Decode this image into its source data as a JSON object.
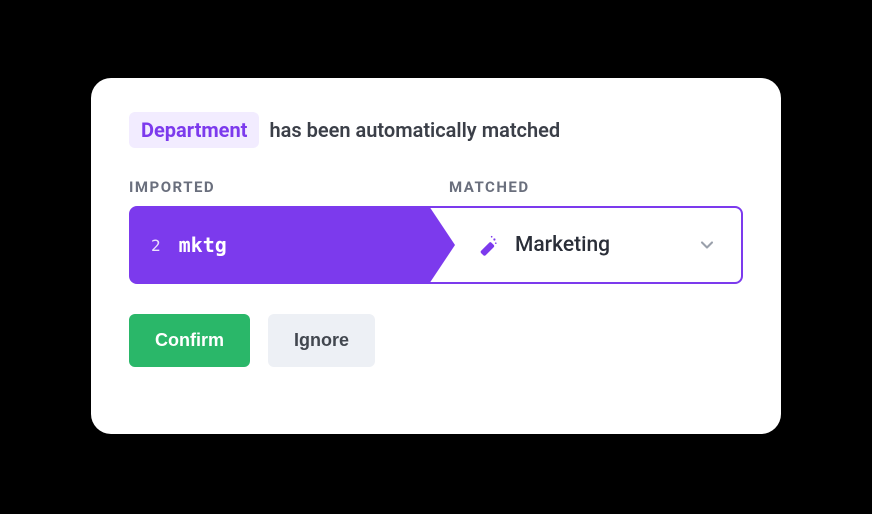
{
  "header": {
    "chip_label": "Department",
    "suffix_text": "has been automatically matched"
  },
  "columns": {
    "imported_label": "IMPORTED",
    "matched_label": "MATCHED"
  },
  "row": {
    "index": "2",
    "imported_value": "mktg",
    "matched_value": "Marketing"
  },
  "buttons": {
    "confirm": "Confirm",
    "ignore": "Ignore"
  }
}
